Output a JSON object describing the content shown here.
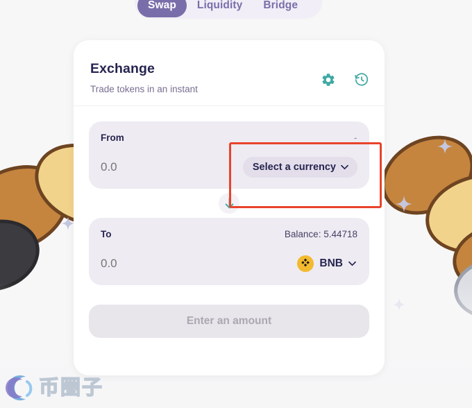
{
  "tabs": [
    {
      "label": "Swap",
      "active": true
    },
    {
      "label": "Liquidity",
      "active": false
    },
    {
      "label": "Bridge",
      "active": false
    }
  ],
  "card": {
    "title": "Exchange",
    "subtitle": "Trade tokens in an instant",
    "icons": {
      "settings": "gear-icon",
      "history": "history-clock-icon"
    }
  },
  "from_panel": {
    "label": "From",
    "balance": "-",
    "amount_value": "0.0",
    "amount_placeholder": "0.0",
    "currency_button": "Select a currency",
    "chevron": "⌄"
  },
  "swap_arrow": {
    "icon": "arrow-down-icon"
  },
  "to_panel": {
    "label": "To",
    "balance": "Balance: 5.44718",
    "amount_value": "0.0",
    "amount_placeholder": "0.0",
    "token_symbol": "BNB",
    "token_icon": "bnb-token-icon",
    "chevron": "⌄"
  },
  "cta": {
    "label": "Enter an amount",
    "disabled": true
  },
  "watermark": {
    "text": "币圈子",
    "logo": "swirl-circle-logo"
  },
  "annotation": {
    "type": "red-rectangle-highlight",
    "color": "#E8432B",
    "target": "select-a-currency-button"
  },
  "colors": {
    "page_background": "#F7F7F8",
    "card_background": "#FFFFFF",
    "panel_background": "#EEEBF2",
    "accent_purple": "#7A6EAA",
    "accent_teal": "#3FA9A3",
    "title_navy": "#262450",
    "bnb_yellow": "#F0B90B",
    "annotation_red": "#E8432B"
  },
  "decorations": {
    "pancakes": "pancake-shapes",
    "sparkles": "sparkle-stars"
  }
}
